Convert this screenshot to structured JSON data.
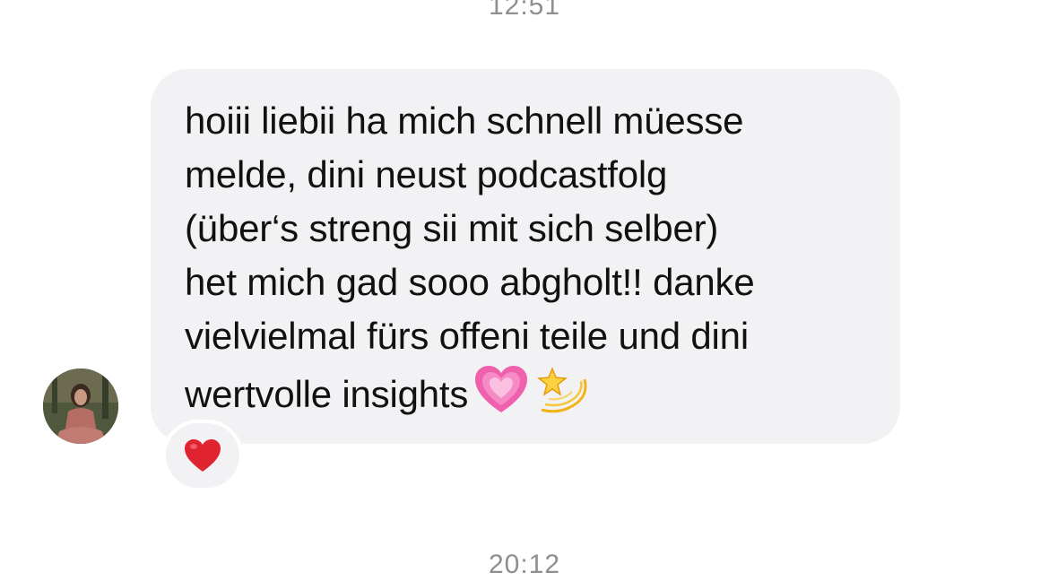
{
  "timestamps": {
    "top": "12:51",
    "bottom": "20:12"
  },
  "message": {
    "sender_avatar": "avatar",
    "lines": [
      "hoiii liebii ha mich schnell müesse",
      "melde, dini neust podcastfolg",
      "(über‘s streng sii mit sich selber)",
      "het mich gad sooo abgholt!! danke",
      "vielvielmal fürs offeni teile und dini",
      "wertvolle insights"
    ],
    "emojis": [
      "growing-heart-icon",
      "dizzy-star-icon"
    ],
    "reaction": "red-heart-icon"
  },
  "colors": {
    "bubble": "#f2f2f5",
    "timestamp": "#8e8e93",
    "text": "#111111",
    "heart_red": "#e0242f",
    "heart_pink": "#f04fa0"
  }
}
